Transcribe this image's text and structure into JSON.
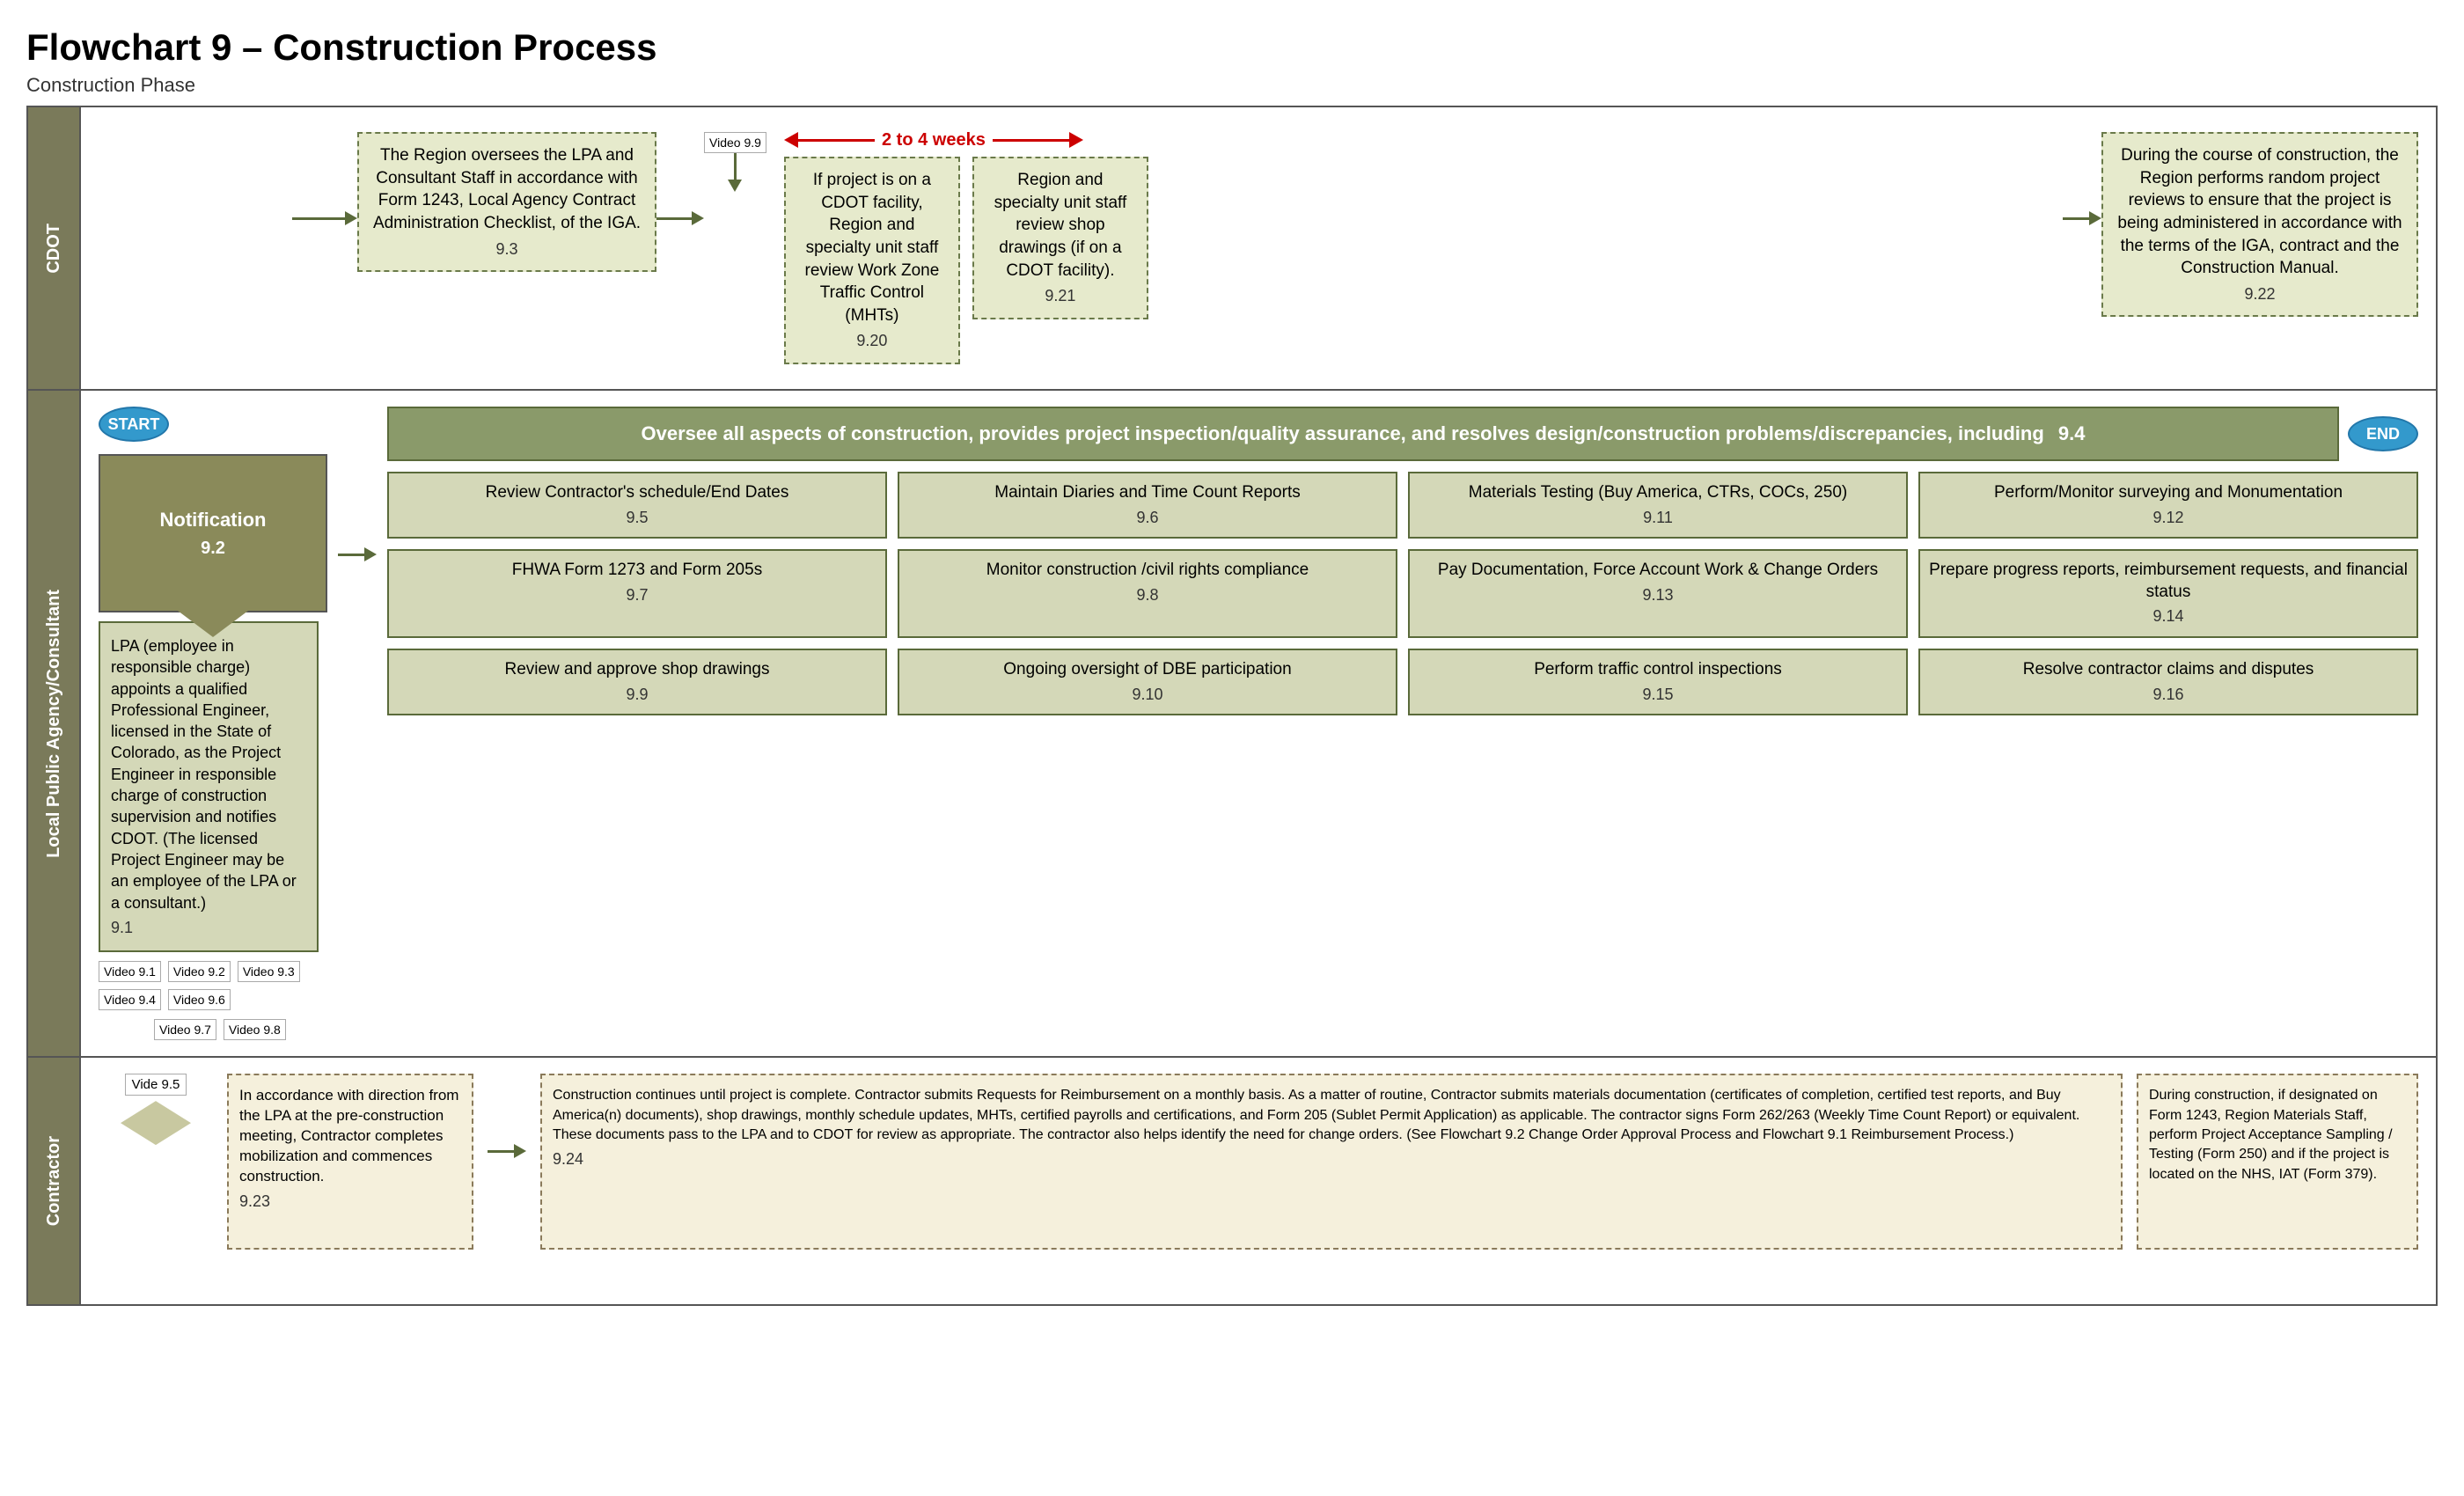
{
  "title": "Flowchart 9 – Construction Process",
  "phase": "Construction Phase",
  "lanes": {
    "cdot": "CDOT",
    "lpa": "Local Public Agency/Consultant",
    "contractor": "Contractor"
  },
  "cdot": {
    "notification": {
      "label": "Notification",
      "num": "9.2"
    },
    "box93": {
      "text": "The Region oversees the LPA and Consultant Staff in accordance with Form 1243, Local Agency Contract Administration Checklist, of the IGA.",
      "num": "9.3"
    },
    "video99": "Video 9.9",
    "weeks": "2 to 4 weeks",
    "box920": {
      "text": "If project is on a CDOT facility, Region and specialty unit staff review Work Zone Traffic Control (MHTs)",
      "num": "9.20"
    },
    "box921": {
      "text": "Region and specialty unit staff  review shop drawings (if on a CDOT facility).",
      "num": "9.21"
    },
    "box922": {
      "text": "During the course of construction, the Region performs random project reviews to ensure that the project is being administered in accordance with the terms of the IGA, contract and the Construction Manual.",
      "num": "9.22"
    }
  },
  "lpa": {
    "start": "START",
    "end": "END",
    "box91": {
      "text": "LPA (employee in responsible charge) appoints a qualified Professional Engineer, licensed in the State of Colorado, as the Project Engineer in responsible charge of construction supervision and notifies CDOT. (The licensed Project Engineer may be an employee of the LPA or a consultant.)",
      "num": "9.1"
    },
    "oversee": {
      "text": "Oversee all aspects of construction, provides project  inspection/quality assurance, and resolves design/construction problems/discrepancies, including",
      "num": "9.4"
    },
    "videos": [
      "Video 9.1",
      "Video 9.2",
      "Video 9.3",
      "Video 9.4",
      "Video 9.6"
    ],
    "videos2": [
      "Video 9.7",
      "Video 9.8"
    ],
    "tasks": [
      {
        "text": "Review Contractor's schedule/End Dates",
        "num": "9.5"
      },
      {
        "text": "Maintain Diaries and Time Count Reports",
        "num": "9.6"
      },
      {
        "text": "Materials Testing (Buy America, CTRs, COCs, 250)",
        "num": "9.11"
      },
      {
        "text": "Perform/Monitor surveying and Monumentation",
        "num": "9.12"
      },
      {
        "text": "FHWA Form 1273 and Form 205s",
        "num": "9.7"
      },
      {
        "text": "Monitor construction /civil rights compliance",
        "num": "9.8"
      },
      {
        "text": "Pay Documentation, Force Account Work & Change Orders",
        "num": "9.13"
      },
      {
        "text": "Prepare progress reports, reimbursement requests, and financial status",
        "num": "9.14"
      },
      {
        "text": "Review and approve shop drawings",
        "num": "9.9"
      },
      {
        "text": "Ongoing oversight of DBE participation",
        "num": "9.10"
      },
      {
        "text": "Perform traffic control inspections",
        "num": "9.15"
      },
      {
        "text": "Resolve contractor claims and disputes",
        "num": "9.16"
      }
    ]
  },
  "contractor": {
    "video95": "Vide 9.5",
    "box923": {
      "text": "In accordance with direction from the LPA at the pre-construction meeting, Contractor completes mobilization and commences construction.",
      "num": "9.23"
    },
    "box924": {
      "text": "Construction continues until project is complete. Contractor submits Requests for Reimbursement on a monthly basis.   As a matter of routine, Contractor submits materials documentation (certificates of completion, certified test reports, and Buy America(n) documents), shop drawings, monthly schedule updates, MHTs, certified payrolls and certifications, and Form 205 (Sublet Permit Application) as applicable.  The contractor signs Form 262/263 (Weekly Time Count Report) or equivalent.  These documents pass to the LPA and to CDOT for review as appropriate.   The contractor also helps identify the need for change orders.  (See Flowchart 9.2 Change Order Approval Process and Flowchart 9.1 Reimbursement Process.)",
      "num": "9.24"
    },
    "box_right": {
      "text": "During construction, if designated on Form 1243, Region Materials Staff, perform Project Acceptance Sampling / Testing (Form 250) and if the project is located on the NHS, IAT (Form 379)."
    }
  },
  "buttons": {
    "start": "START",
    "end": "END"
  }
}
